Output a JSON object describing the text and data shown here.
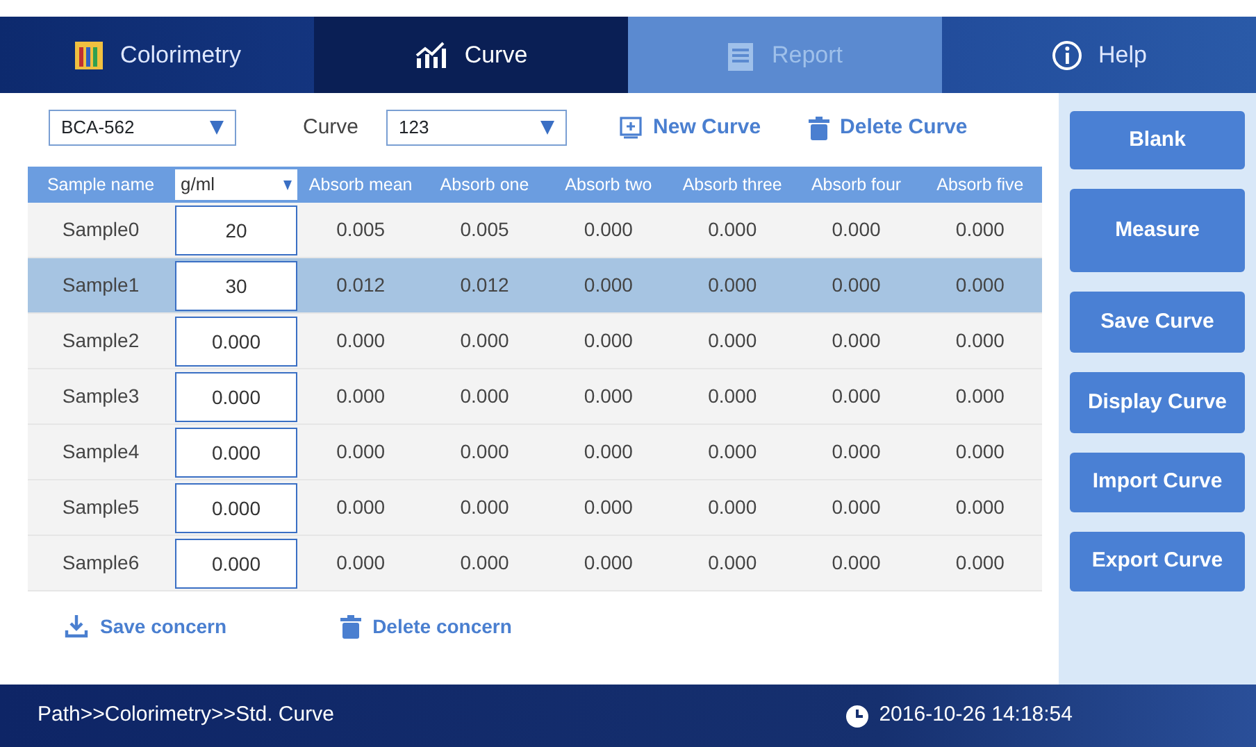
{
  "tabs": [
    {
      "label": "Colorimetry",
      "selected": false,
      "disabled": false
    },
    {
      "label": "Curve",
      "selected": true,
      "disabled": false
    },
    {
      "label": "Report",
      "selected": false,
      "disabled": true
    },
    {
      "label": "Help",
      "selected": false,
      "disabled": false
    }
  ],
  "toolbar": {
    "method": "BCA-562",
    "curve_label": "Curve",
    "curve": "123",
    "new_curve": "New Curve",
    "delete_curve": "Delete Curve"
  },
  "table": {
    "columns": [
      "Sample name",
      "g/ml",
      "Absorb mean",
      "Absorb one",
      "Absorb two",
      "Absorb three",
      "Absorb four",
      "Absorb five"
    ],
    "rows": [
      {
        "selected": false,
        "cells": [
          "Sample0",
          "20",
          "0.005",
          "0.005",
          "0.000",
          "0.000",
          "0.000",
          "0.000"
        ]
      },
      {
        "selected": true,
        "cells": [
          "Sample1",
          "30",
          "0.012",
          "0.012",
          "0.000",
          "0.000",
          "0.000",
          "0.000"
        ]
      },
      {
        "selected": false,
        "cells": [
          "Sample2",
          "0.000",
          "0.000",
          "0.000",
          "0.000",
          "0.000",
          "0.000",
          "0.000"
        ]
      },
      {
        "selected": false,
        "cells": [
          "Sample3",
          "0.000",
          "0.000",
          "0.000",
          "0.000",
          "0.000",
          "0.000",
          "0.000"
        ]
      },
      {
        "selected": false,
        "cells": [
          "Sample4",
          "0.000",
          "0.000",
          "0.000",
          "0.000",
          "0.000",
          "0.000",
          "0.000"
        ]
      },
      {
        "selected": false,
        "cells": [
          "Sample5",
          "0.000",
          "0.000",
          "0.000",
          "0.000",
          "0.000",
          "0.000",
          "0.000"
        ]
      },
      {
        "selected": false,
        "cells": [
          "Sample6",
          "0.000",
          "0.000",
          "0.000",
          "0.000",
          "0.000",
          "0.000",
          "0.000"
        ]
      }
    ]
  },
  "actions": [
    {
      "label": "Save concern",
      "kind": "save"
    },
    {
      "label": "Delete concern",
      "kind": "delete"
    }
  ],
  "side_buttons": [
    "Blank",
    "Measure",
    "Save Curve",
    "Display Curve",
    "Import Curve",
    "Export Curve"
  ],
  "status_bar": {
    "path": "Path>>Colorimetry>>Std. Curve",
    "datetime": "2016-10-26 14:18:54"
  }
}
